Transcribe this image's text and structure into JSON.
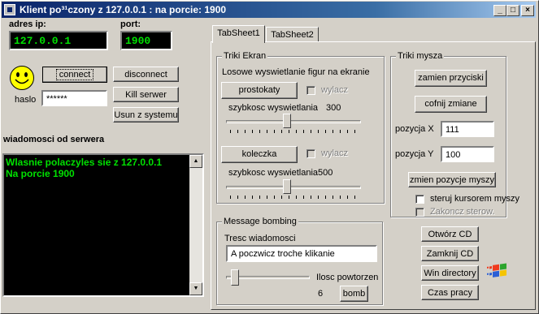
{
  "window": {
    "title": "Klient po³¹czony z 127.0.0.1 : na porcie: 1900",
    "min": "_",
    "max": "□",
    "close": "×"
  },
  "left": {
    "ip_label": "adres ip:",
    "ip_value": "127.0.0.1",
    "port_label": "port:",
    "port_value": "1900",
    "connect": "connect",
    "disconnect": "disconnect",
    "haslo_label": "haslo",
    "haslo_value": "******",
    "kill": "Kill serwer",
    "usun": "Usun z systemu",
    "messages_title": "wiadomosci od serwera",
    "messages": [
      "Wlasnie polaczyles sie z 127.0.0.1",
      "Na porcie 1900"
    ]
  },
  "tabs": [
    "TabSheet1",
    "TabSheet2"
  ],
  "triki_ekran": {
    "title": "Triki Ekran",
    "desc": "Losowe wyswietlanie figur na ekranie",
    "prostokaty": "prostokaty",
    "wylacz1": "wylacz",
    "speed_label1": "szybkosc wyswietlania",
    "speed1": "300",
    "slider1_level": 0.45,
    "koleczka": "koleczka",
    "wylacz2": "wylacz",
    "speed_label2": "szybkosc wyswietlania",
    "speed2": "500",
    "slider2_level": 0.45
  },
  "triki_mysza": {
    "title": "Triki mysza",
    "zamien": "zamien przyciski",
    "cofnij": "cofnij zmiane",
    "pos_x_label": "pozycja X",
    "pos_x": "111",
    "pos_y_label": "pozycja Y",
    "pos_y": "100",
    "zmien": "zmien pozycje myszy",
    "steruj": "steruj kursorem myszy",
    "zakoncz": "Zakoncz sterow."
  },
  "bombing": {
    "title": "Message bombing",
    "tresc_label": "Tresc wiadomosci",
    "tresc": "A poczwicz troche klikanie",
    "ilosc_label": "Ilosc powtorzen",
    "ilosc": "6",
    "bomb": "bomb",
    "slider_level": 0.06
  },
  "actions": {
    "otworz": "Otwórz CD",
    "zamknij": "Zamknij CD",
    "windir": "Win directory",
    "czas": "Czas pracy"
  }
}
